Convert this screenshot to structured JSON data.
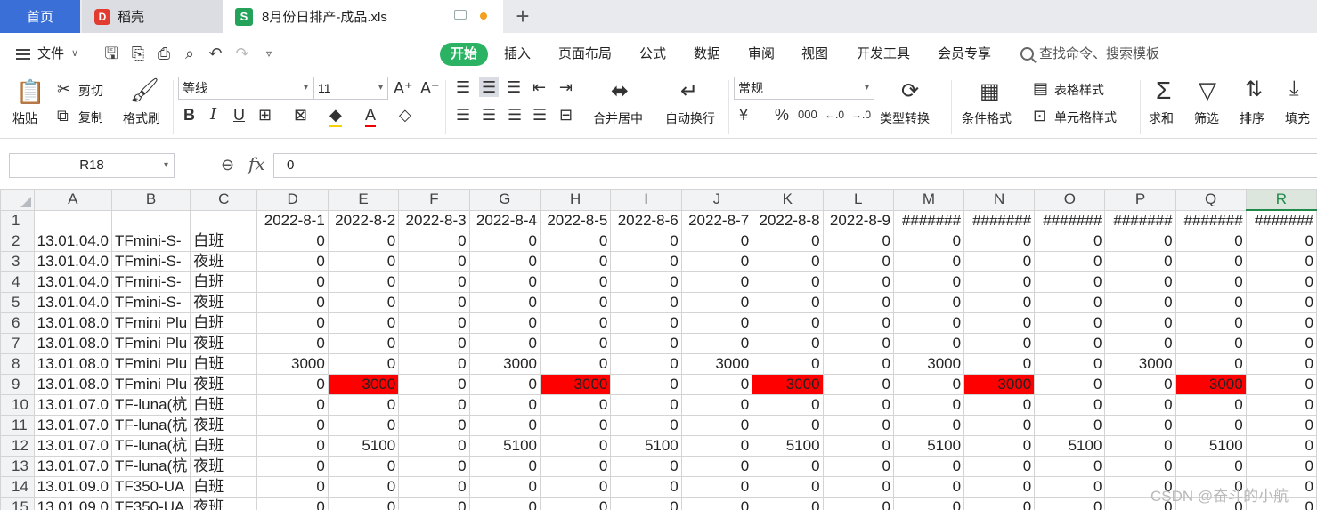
{
  "tabs": {
    "home": "首页",
    "docer": "稻壳",
    "docer_logo": "D",
    "file_logo": "S",
    "file": "8月份日排产-成品.xls",
    "new_tab": "+"
  },
  "menu": {
    "file": "文件",
    "items": [
      "插入",
      "页面布局",
      "公式",
      "数据",
      "审阅",
      "视图",
      "开发工具",
      "会员专享"
    ],
    "active": "开始",
    "search": "查找命令、搜索模板"
  },
  "ribbon": {
    "paste": "粘贴",
    "cut": "剪切",
    "copy": "复制",
    "format_painter": "格式刷",
    "font_name": "等线",
    "font_size": "11",
    "merge_center": "合并居中",
    "wrap_text": "自动换行",
    "number_format": "常规",
    "type_convert": "类型转换",
    "cond_format": "条件格式",
    "table_style": "表格样式",
    "cell_style": "单元格样式",
    "sum": "求和",
    "filter": "筛选",
    "sort": "排序",
    "fill": "填充",
    "currency_symbol": "¥",
    "percent_symbol": "%",
    "thousands_symbol": "000"
  },
  "formula_bar": {
    "cell_ref": "R18",
    "fx": "fx",
    "value": "0"
  },
  "sheet": {
    "selected_column": "R",
    "columns": [
      "A",
      "B",
      "C",
      "D",
      "E",
      "F",
      "G",
      "H",
      "I",
      "J",
      "K",
      "L",
      "M",
      "N",
      "O",
      "P",
      "Q",
      "R"
    ],
    "header_row": [
      "",
      "",
      "",
      "2022-8-1",
      "2022-8-2",
      "2022-8-3",
      "2022-8-4",
      "2022-8-5",
      "2022-8-6",
      "2022-8-7",
      "2022-8-8",
      "2022-8-9",
      "#######",
      "#######",
      "#######",
      "#######",
      "#######",
      "#######"
    ],
    "rows": [
      {
        "n": "2",
        "a": "13.01.04.0",
        "b": "TFmini-S-",
        "c": "白班",
        "v": [
          "0",
          "0",
          "0",
          "0",
          "0",
          "0",
          "0",
          "0",
          "0",
          "0",
          "0",
          "0",
          "0",
          "0",
          "0"
        ]
      },
      {
        "n": "3",
        "a": "13.01.04.0",
        "b": "TFmini-S-",
        "c": "夜班",
        "v": [
          "0",
          "0",
          "0",
          "0",
          "0",
          "0",
          "0",
          "0",
          "0",
          "0",
          "0",
          "0",
          "0",
          "0",
          "0"
        ]
      },
      {
        "n": "4",
        "a": "13.01.04.0",
        "b": "TFmini-S-",
        "c": "白班",
        "v": [
          "0",
          "0",
          "0",
          "0",
          "0",
          "0",
          "0",
          "0",
          "0",
          "0",
          "0",
          "0",
          "0",
          "0",
          "0"
        ]
      },
      {
        "n": "5",
        "a": "13.01.04.0",
        "b": "TFmini-S-",
        "c": "夜班",
        "v": [
          "0",
          "0",
          "0",
          "0",
          "0",
          "0",
          "0",
          "0",
          "0",
          "0",
          "0",
          "0",
          "0",
          "0",
          "0"
        ]
      },
      {
        "n": "6",
        "a": "13.01.08.0",
        "b": "TFmini Plu",
        "c": "白班",
        "v": [
          "0",
          "0",
          "0",
          "0",
          "0",
          "0",
          "0",
          "0",
          "0",
          "0",
          "0",
          "0",
          "0",
          "0",
          "0"
        ]
      },
      {
        "n": "7",
        "a": "13.01.08.0",
        "b": "TFmini Plu",
        "c": "夜班",
        "v": [
          "0",
          "0",
          "0",
          "0",
          "0",
          "0",
          "0",
          "0",
          "0",
          "0",
          "0",
          "0",
          "0",
          "0",
          "0"
        ]
      },
      {
        "n": "8",
        "a": "13.01.08.0",
        "b": "TFmini Plu",
        "c": "白班",
        "v": [
          "3000",
          "0",
          "0",
          "3000",
          "0",
          "0",
          "3000",
          "0",
          "0",
          "3000",
          "0",
          "0",
          "3000",
          "0",
          "0"
        ]
      },
      {
        "n": "9",
        "a": "13.01.08.0",
        "b": "TFmini Plu",
        "c": "夜班",
        "v": [
          "0",
          "3000",
          "0",
          "0",
          "3000",
          "0",
          "0",
          "3000",
          "0",
          "0",
          "3000",
          "0",
          "0",
          "3000",
          "0"
        ],
        "red": [
          1,
          4,
          7,
          10,
          13
        ]
      },
      {
        "n": "10",
        "a": "13.01.07.0",
        "b": "TF-luna(杭",
        "c": "白班",
        "v": [
          "0",
          "0",
          "0",
          "0",
          "0",
          "0",
          "0",
          "0",
          "0",
          "0",
          "0",
          "0",
          "0",
          "0",
          "0"
        ]
      },
      {
        "n": "11",
        "a": "13.01.07.0",
        "b": "TF-luna(杭",
        "c": "夜班",
        "v": [
          "0",
          "0",
          "0",
          "0",
          "0",
          "0",
          "0",
          "0",
          "0",
          "0",
          "0",
          "0",
          "0",
          "0",
          "0"
        ]
      },
      {
        "n": "12",
        "a": "13.01.07.0",
        "b": "TF-luna(杭",
        "c": "白班",
        "v": [
          "0",
          "5100",
          "0",
          "5100",
          "0",
          "5100",
          "0",
          "5100",
          "0",
          "5100",
          "0",
          "5100",
          "0",
          "5100",
          "0"
        ]
      },
      {
        "n": "13",
        "a": "13.01.07.0",
        "b": "TF-luna(杭",
        "c": "夜班",
        "v": [
          "0",
          "0",
          "0",
          "0",
          "0",
          "0",
          "0",
          "0",
          "0",
          "0",
          "0",
          "0",
          "0",
          "0",
          "0"
        ]
      },
      {
        "n": "14",
        "a": "13.01.09.0",
        "b": "TF350-UA",
        "c": "白班",
        "v": [
          "0",
          "0",
          "0",
          "0",
          "0",
          "0",
          "0",
          "0",
          "0",
          "0",
          "0",
          "0",
          "0",
          "0",
          "0"
        ]
      },
      {
        "n": "15",
        "a": "13.01.09.0",
        "b": "TF350-UA",
        "c": "夜班",
        "v": [
          "0",
          "0",
          "0",
          "0",
          "0",
          "0",
          "0",
          "0",
          "0",
          "0",
          "0",
          "0",
          "0",
          "0",
          "0"
        ]
      }
    ]
  },
  "watermark": "CSDN @奋斗的小航"
}
